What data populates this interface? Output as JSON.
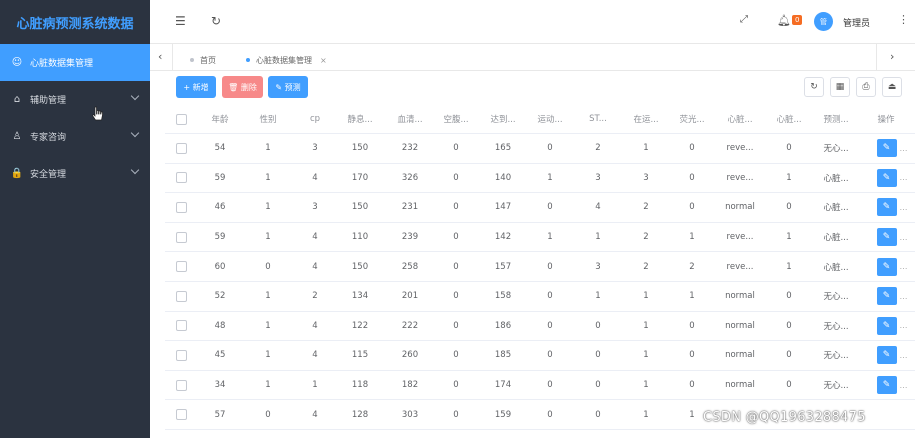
{
  "app": {
    "title": "心脏病预测系统数据"
  },
  "sidebar": {
    "items": [
      {
        "label": "心脏数据集管理",
        "icon": "smile-icon",
        "glyph": "☺",
        "active": true,
        "expandable": false
      },
      {
        "label": "辅助管理",
        "icon": "home-icon",
        "glyph": "⌂",
        "active": false,
        "expandable": true
      },
      {
        "label": "专家咨询",
        "icon": "user-icon",
        "glyph": "♙",
        "active": false,
        "expandable": true
      },
      {
        "label": "安全管理",
        "icon": "lock-icon",
        "glyph": "🔒",
        "active": false,
        "expandable": true
      }
    ]
  },
  "topbar": {
    "badge_count": "0",
    "avatar_text": "管",
    "user_label": "管理员"
  },
  "tabs": [
    {
      "label": "首页",
      "active": false,
      "closable": false
    },
    {
      "label": "心脏数据集管理",
      "active": true,
      "closable": true
    }
  ],
  "toolbar": {
    "add_label": "+ 新增",
    "delete_label": "🗑 删除",
    "predict_label": "✎ 预测"
  },
  "table": {
    "columns": [
      "年龄",
      "性别",
      "cp",
      "静息...",
      "血清...",
      "空腹...",
      "达到...",
      "运动...",
      "ST...",
      "在运...",
      "荧光...",
      "心脏...",
      "心脏...",
      "预测...",
      "操作"
    ],
    "rows": [
      [
        "54",
        "1",
        "3",
        "150",
        "232",
        "0",
        "165",
        "0",
        "2",
        "1",
        "0",
        "reve...",
        "0",
        "无心..."
      ],
      [
        "59",
        "1",
        "4",
        "170",
        "326",
        "0",
        "140",
        "1",
        "3",
        "3",
        "0",
        "reve...",
        "1",
        "心脏..."
      ],
      [
        "46",
        "1",
        "3",
        "150",
        "231",
        "0",
        "147",
        "0",
        "4",
        "2",
        "0",
        "normal",
        "0",
        "心脏..."
      ],
      [
        "59",
        "1",
        "4",
        "110",
        "239",
        "0",
        "142",
        "1",
        "1",
        "2",
        "1",
        "reve...",
        "1",
        "心脏..."
      ],
      [
        "60",
        "0",
        "4",
        "150",
        "258",
        "0",
        "157",
        "0",
        "3",
        "2",
        "2",
        "reve...",
        "1",
        "心脏..."
      ],
      [
        "52",
        "1",
        "2",
        "134",
        "201",
        "0",
        "158",
        "0",
        "1",
        "1",
        "1",
        "normal",
        "0",
        "无心..."
      ],
      [
        "48",
        "1",
        "4",
        "122",
        "222",
        "0",
        "186",
        "0",
        "0",
        "1",
        "0",
        "normal",
        "0",
        "无心..."
      ],
      [
        "45",
        "1",
        "4",
        "115",
        "260",
        "0",
        "185",
        "0",
        "0",
        "1",
        "0",
        "normal",
        "0",
        "无心..."
      ],
      [
        "34",
        "1",
        "1",
        "118",
        "182",
        "0",
        "174",
        "0",
        "0",
        "1",
        "0",
        "normal",
        "0",
        "无心..."
      ],
      [
        "57",
        "0",
        "4",
        "128",
        "303",
        "0",
        "159",
        "0",
        "0",
        "1",
        "1",
        "",
        "",
        ""
      ]
    ]
  },
  "watermark": "CSDN @QQ1963288475",
  "colors": {
    "sidebar_bg": "#2b3340",
    "accent": "#409eff",
    "danger": "#f78989",
    "badge": "#f56c23"
  }
}
